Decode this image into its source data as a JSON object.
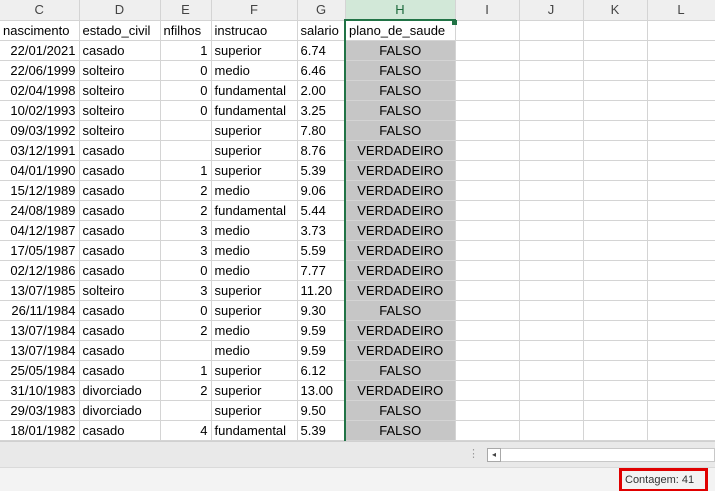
{
  "columns": [
    {
      "letter": "C",
      "header": "nascimento"
    },
    {
      "letter": "D",
      "header": "estado_civil"
    },
    {
      "letter": "E",
      "header": "nfilhos"
    },
    {
      "letter": "F",
      "header": "instrucao"
    },
    {
      "letter": "G",
      "header": "salario"
    },
    {
      "letter": "H",
      "header": "plano_de_saude"
    },
    {
      "letter": "I",
      "header": ""
    },
    {
      "letter": "J",
      "header": ""
    },
    {
      "letter": "K",
      "header": ""
    },
    {
      "letter": "L",
      "header": ""
    }
  ],
  "selected_column": "H",
  "rows": [
    [
      "22/01/2021",
      "casado",
      "1",
      "superior",
      "6.74",
      "FALSO"
    ],
    [
      "22/06/1999",
      "solteiro",
      "0",
      "medio",
      "6.46",
      "FALSO"
    ],
    [
      "02/04/1998",
      "solteiro",
      "0",
      "fundamental",
      "2.00",
      "FALSO"
    ],
    [
      "10/02/1993",
      "solteiro",
      "0",
      "fundamental",
      "3.25",
      "FALSO"
    ],
    [
      "09/03/1992",
      "solteiro",
      "",
      "superior",
      "7.80",
      "FALSO"
    ],
    [
      "03/12/1991",
      "casado",
      "",
      "superior",
      "8.76",
      "VERDADEIRO"
    ],
    [
      "04/01/1990",
      "casado",
      "1",
      "superior",
      "5.39",
      "VERDADEIRO"
    ],
    [
      "15/12/1989",
      "casado",
      "2",
      "medio",
      "9.06",
      "VERDADEIRO"
    ],
    [
      "24/08/1989",
      "casado",
      "2",
      "fundamental",
      "5.44",
      "VERDADEIRO"
    ],
    [
      "04/12/1987",
      "casado",
      "3",
      "medio",
      "3.73",
      "VERDADEIRO"
    ],
    [
      "17/05/1987",
      "casado",
      "3",
      "medio",
      "5.59",
      "VERDADEIRO"
    ],
    [
      "02/12/1986",
      "casado",
      "0",
      "medio",
      "7.77",
      "VERDADEIRO"
    ],
    [
      "13/07/1985",
      "solteiro",
      "3",
      "superior",
      "11.20",
      "VERDADEIRO"
    ],
    [
      "26/11/1984",
      "casado",
      "0",
      "superior",
      "9.30",
      "FALSO"
    ],
    [
      "13/07/1984",
      "casado",
      "2",
      "medio",
      "9.59",
      "VERDADEIRO"
    ],
    [
      "13/07/1984",
      "casado",
      "",
      "medio",
      "9.59",
      "VERDADEIRO"
    ],
    [
      "25/05/1984",
      "casado",
      "1",
      "superior",
      "6.12",
      "FALSO"
    ],
    [
      "31/10/1983",
      "divorciado",
      "2",
      "superior",
      "13.00",
      "VERDADEIRO"
    ],
    [
      "29/03/1983",
      "divorciado",
      "",
      "superior",
      "9.50",
      "FALSO"
    ],
    [
      "18/01/1982",
      "casado",
      "4",
      "fundamental",
      "5.39",
      "FALSO"
    ]
  ],
  "status_bar": {
    "count_label": "Contagem: 41",
    "highlight_color": "#e00000"
  },
  "icons": {
    "scroll_left": "◂",
    "split_handle": "⋮"
  },
  "colors": {
    "selection_green": "#217346",
    "selected_cell_fill": "#c6c6c6"
  }
}
